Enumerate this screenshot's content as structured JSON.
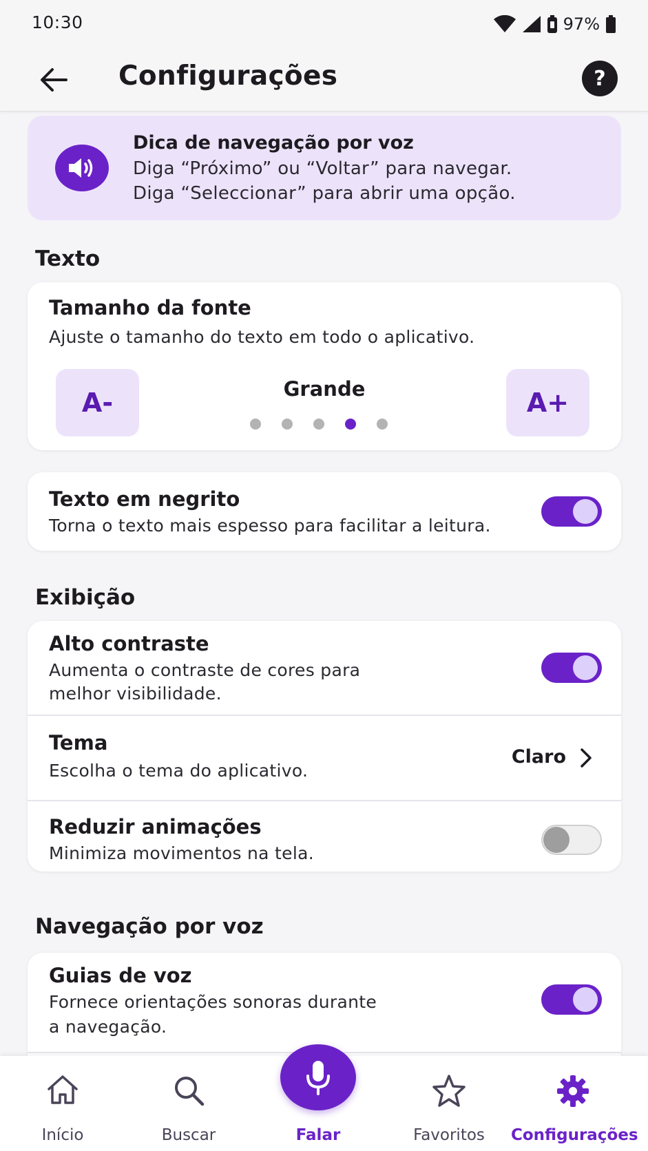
{
  "status_bar": {
    "time": "10:30",
    "battery": "97%"
  },
  "app_bar": {
    "title": "Configurações"
  },
  "tip": {
    "title": "Dica de navegação por voz",
    "line1": "Diga “Próximo” ou “Voltar” para navegar.",
    "line2": "Diga “Seleccionar” para abrir uma opção."
  },
  "sections": {
    "text": "Texto",
    "display": "Exibição",
    "voice": "Navegação por voz"
  },
  "font_size": {
    "title": "Tamanho da fonte",
    "description": "Ajuste o tamanho do texto em todo o aplicativo.",
    "decrease_label": "A-",
    "increase_label": "A+",
    "current": "Grande",
    "level": 4,
    "levels": 5
  },
  "bold_text": {
    "title": "Texto em negrito",
    "description": "Torna o texto mais espesso para facilitar a leitura.",
    "enabled": true
  },
  "high_contrast": {
    "title": "Alto contraste",
    "description_line1": "Aumenta o contraste de cores para",
    "description_line2": "melhor visibilidade.",
    "enabled": true
  },
  "theme": {
    "title": "Tema",
    "description": "Escolha o tema do aplicativo.",
    "value": "Claro"
  },
  "reduce_motion": {
    "title": "Reduzir animações",
    "description": "Minimiza movimentos na tela.",
    "enabled": false
  },
  "voice_guides": {
    "title": "Guias de voz",
    "description_line1": "Fornece orientações sonoras durante",
    "description_line2": "a navegação.",
    "enabled": true
  },
  "bottom_nav": {
    "home": "Início",
    "search": "Buscar",
    "speak": "Falar",
    "favorites": "Favoritos",
    "settings": "Configurações",
    "active": "settings"
  },
  "colors": {
    "accent": "#6a22c8",
    "accent_light": "#ece3fb",
    "background": "#f5f4f7",
    "card": "#ffffff"
  }
}
